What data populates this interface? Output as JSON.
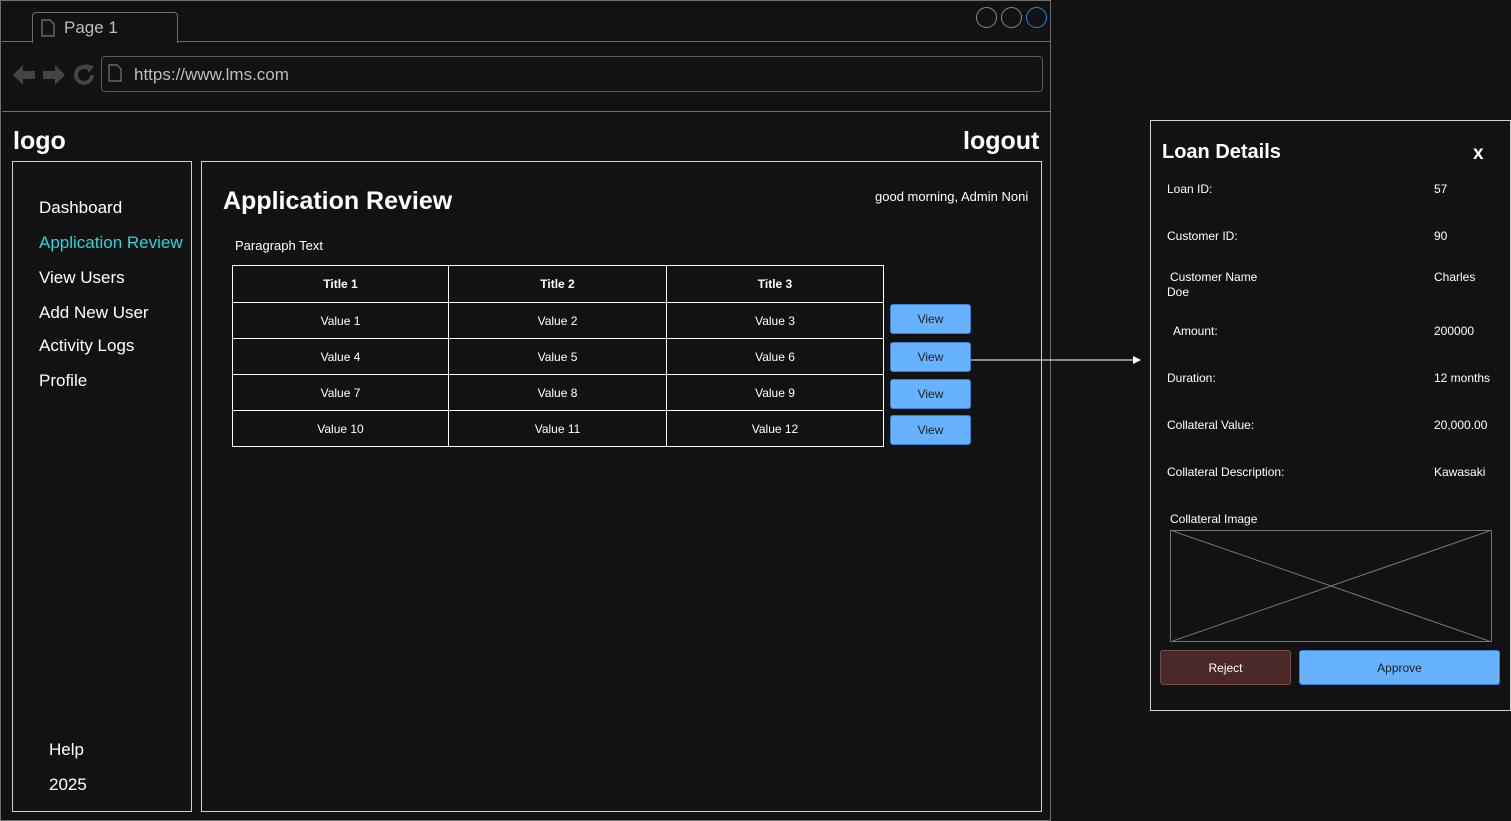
{
  "browser": {
    "tab_label": "Page 1",
    "url": "https://www.lms.com",
    "icons": [
      "back-icon",
      "forward-icon",
      "reload-icon",
      "page-icon",
      "window-control-icon"
    ]
  },
  "header": {
    "logo": "logo",
    "logout": "logout"
  },
  "sidebar": {
    "items": [
      {
        "label": "Dashboard",
        "active": false
      },
      {
        "label": "Application Review",
        "active": true
      },
      {
        "label": "View Users",
        "active": false
      },
      {
        "label": "Add New User",
        "active": false
      },
      {
        "label": "Activity Logs",
        "active": false
      },
      {
        "label": "Profile",
        "active": false
      }
    ],
    "help": "Help",
    "year": "2025",
    "accent_color": "#2cd5dd"
  },
  "main": {
    "title": "Application Review",
    "greeting": "good morning, Admin Noni",
    "paragraph": "Paragraph Text",
    "table": {
      "headers": [
        "Title 1",
        "Title 2",
        "Title 3"
      ],
      "rows": [
        [
          "Value 1",
          "Value 2",
          "Value 3"
        ],
        [
          "Value 4",
          "Value 5",
          "Value 6"
        ],
        [
          "Value 7",
          "Value 8",
          "Value 9"
        ],
        [
          "Value 10",
          "Value 11",
          "Value 12"
        ]
      ],
      "action_label": "View"
    }
  },
  "modal": {
    "title": "Loan Details",
    "close": "x",
    "fields": [
      {
        "label": "Loan ID:",
        "value": "57"
      },
      {
        "label": "Customer ID:",
        "value": "90"
      },
      {
        "label": "Customer Name",
        "value": "Charles"
      },
      {
        "label": "Doe",
        "value": ""
      },
      {
        "label": "Amount:",
        "value": "200000"
      },
      {
        "label": "Duration:",
        "value": "12 months"
      },
      {
        "label": "Collateral Value:",
        "value": "20,000.00"
      },
      {
        "label": "Collateral Description:",
        "value": "Kawasaki"
      }
    ],
    "image_caption": "Collateral Image",
    "reject": "Reject",
    "approve": "Approve",
    "colors": {
      "approve": "#66b2ff",
      "reject": "#4a2828"
    }
  }
}
